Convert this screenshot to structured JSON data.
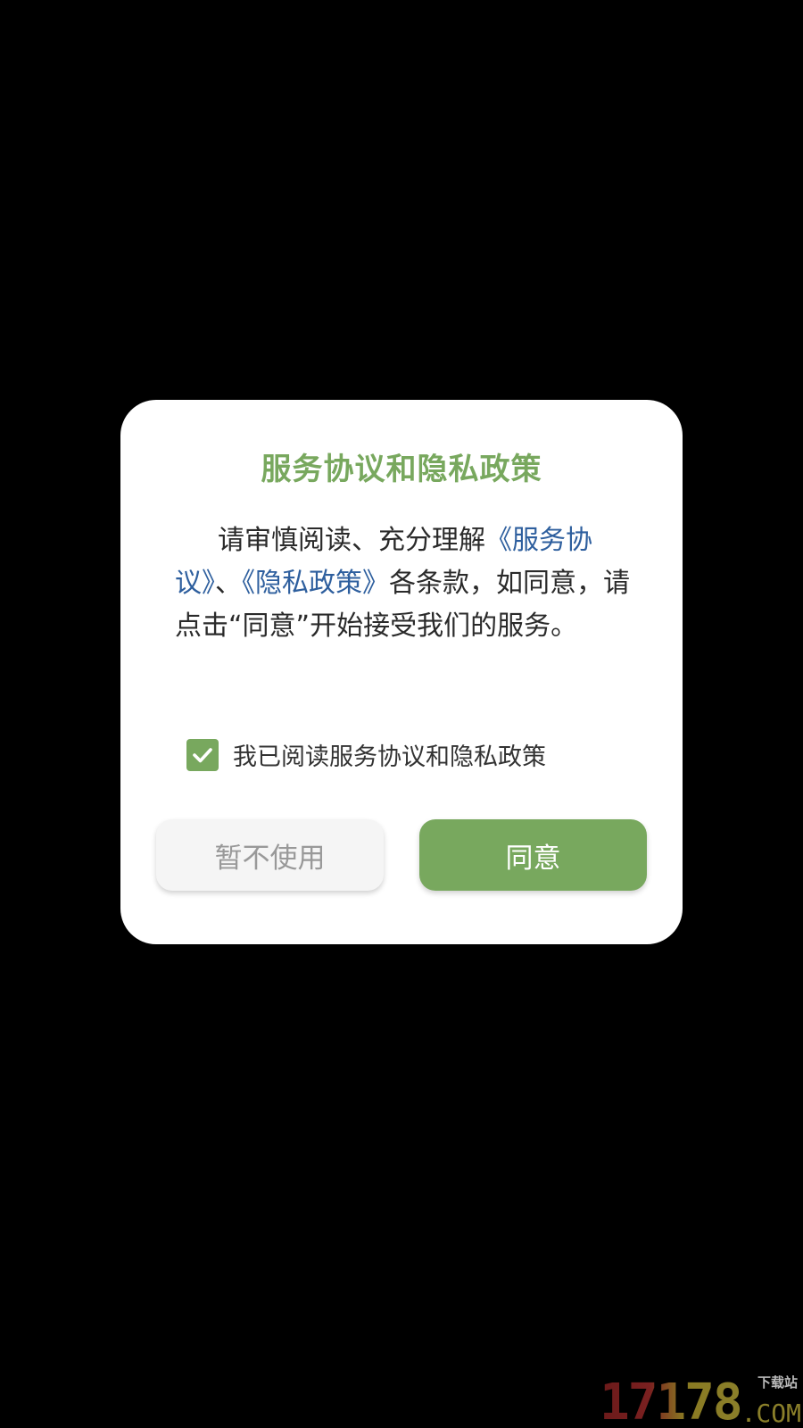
{
  "dialog": {
    "title": "服务协议和隐私政策",
    "body": {
      "part1": "请审慎阅读、充分理解",
      "link_service": "《服务协议》",
      "separator": "、",
      "link_privacy": "《隐私政策》",
      "part2": "各条款，如同意，请点击“同意”开始接受我们的服务。"
    },
    "checkbox": {
      "checked": true,
      "label": "我已阅读服务协议和隐私政策"
    },
    "buttons": {
      "decline_label": "暂不使用",
      "agree_label": "同意"
    }
  },
  "watermark": {
    "digits": "17178",
    "sub": "下载站",
    "com": ".COM"
  },
  "colors": {
    "accent": "#78a85e",
    "link": "#2e5f9e",
    "background": "#000000"
  }
}
